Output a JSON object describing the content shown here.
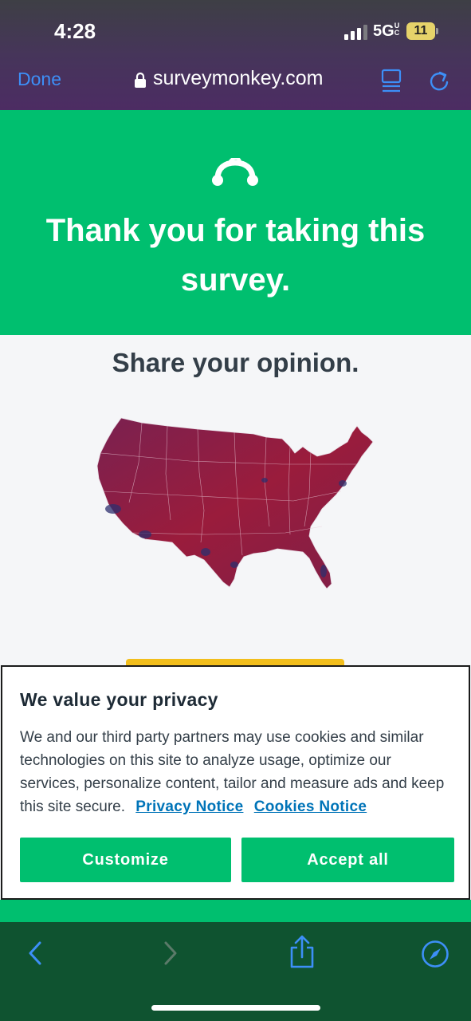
{
  "status_bar": {
    "time": "4:28",
    "network": "5G",
    "network_suffix": "UC",
    "battery": "11"
  },
  "browser": {
    "done_label": "Done",
    "url": "surveymonkey.com"
  },
  "hero": {
    "title": "Thank you for taking this survey."
  },
  "content": {
    "heading": "Share your opinion."
  },
  "privacy": {
    "title": "We value your privacy",
    "body": "We and our third party partners may use cookies and similar technologies on this site to analyze usage, optimize our services, personalize content, tailor and measure ads and keep this site secure.",
    "privacy_link": "Privacy Notice",
    "cookies_link": "Cookies Notice",
    "customize_label": "Customize",
    "accept_label": "Accept all"
  },
  "toolbar": {
    "icons": [
      "back-icon",
      "forward-icon",
      "share-icon",
      "compass-icon"
    ]
  },
  "colors": {
    "brand_green": "#00bf6f",
    "map_red": "#8e1c3f",
    "map_blue": "#2d2f6e",
    "link_blue": "#0074b8",
    "cta_yellow": "#f2be1c",
    "toolbar_green": "#0f5330"
  }
}
